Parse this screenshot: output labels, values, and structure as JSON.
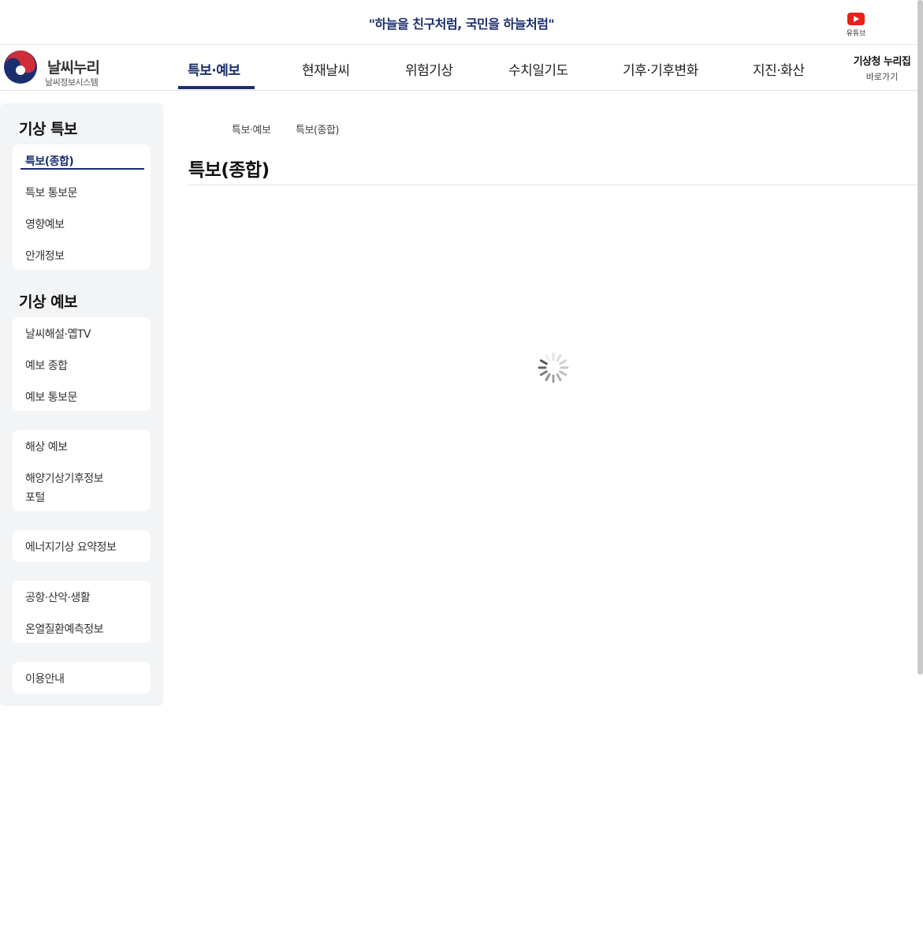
{
  "banner": {
    "slogan": "\"하늘을 친구처럼, 국민을 하늘처럼\"",
    "youtube_label": "유튜브"
  },
  "brand": {
    "title": "날씨누리",
    "subtitle": "날씨정보시스템"
  },
  "nav": {
    "items": [
      {
        "label": "특보·예보",
        "active": true
      },
      {
        "label": "현재날씨"
      },
      {
        "label": "위험기상"
      },
      {
        "label": "수치일기도"
      },
      {
        "label": "기후·기후변화"
      },
      {
        "label": "지진·화산"
      }
    ],
    "shortcut_title": "기상청 누리집",
    "shortcut_sub": "바로가기"
  },
  "sidebar": {
    "section1_title": "기상 특보",
    "group1": [
      "특보(종합)",
      "특보 통보문",
      "영향예보",
      "안개정보"
    ],
    "section2_title": "기상 예보",
    "group2": [
      "날씨해설·옙TV",
      "예보 종합",
      "예보 통보문"
    ],
    "group3": [
      "해상 예보",
      "해양기상기후정보",
      "포털"
    ],
    "group4": [
      "에너지기상 요약정보"
    ],
    "group5": [
      "공항·산악·생활",
      "온열질환예측정보"
    ],
    "group6": [
      "이용안내"
    ]
  },
  "content": {
    "breadcrumb": [
      "특보·예보",
      "특보(종합)"
    ],
    "page_title": "특보(종합)"
  },
  "colors": {
    "accent": "#1a2e6e",
    "youtube": "#e62117",
    "sidebar_bg": "#f3f4f6"
  }
}
